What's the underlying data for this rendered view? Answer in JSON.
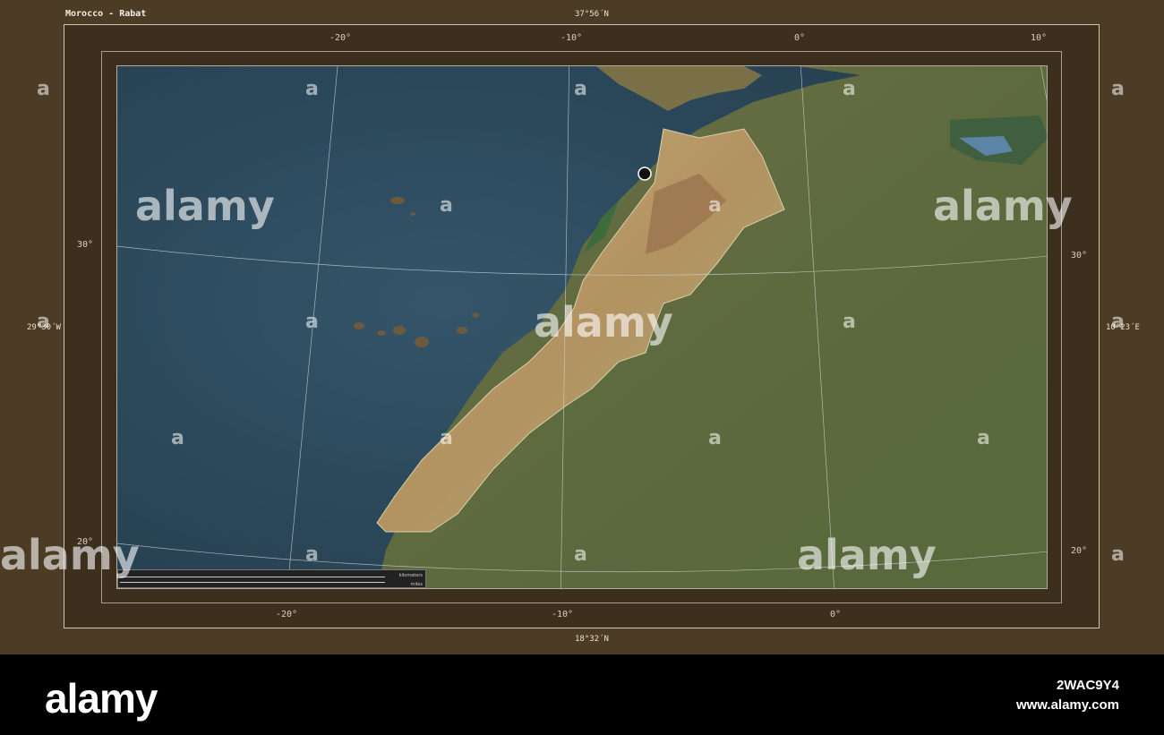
{
  "map": {
    "title": "Morocco - Rabat",
    "bounds": {
      "north": "37°56´N",
      "south": "18°32´N",
      "west": "29°30´W",
      "east": "10°23´E"
    },
    "top_longitude_ticks": [
      "-20°",
      "-10°",
      "0°",
      "10°"
    ],
    "bottom_longitude_ticks": [
      "-20°",
      "-10°",
      "0°"
    ],
    "left_latitude_ticks": [
      "30°",
      "20°"
    ],
    "right_latitude_ticks": [
      "30°",
      "20°"
    ],
    "capital_marker": "Rabat",
    "scale_units": [
      "kilometers",
      "miles"
    ],
    "colors": {
      "ocean": "#2e4b5c",
      "land": "#5b6a3c",
      "highlight": "#b5a06a",
      "frame": "#4c3c26"
    }
  },
  "watermarks": {
    "brand": "alamy",
    "small_mark": "a"
  },
  "footer": {
    "logo": "alamy",
    "image_id": "2WAC9Y4",
    "url": "www.alamy.com"
  }
}
